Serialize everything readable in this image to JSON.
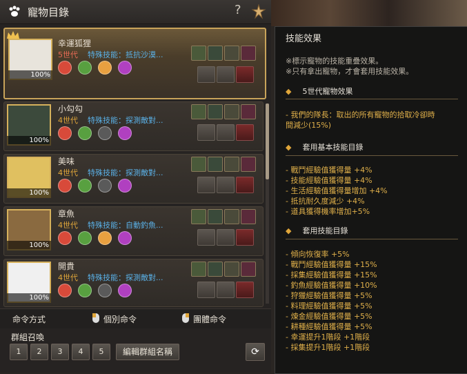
{
  "window": {
    "title": "寵物目錄",
    "help": "?"
  },
  "pets": [
    {
      "name": "幸運狐狸",
      "gen": "5世代",
      "skill": "特殊技能：抵抗沙漠...",
      "pct": "100%"
    },
    {
      "name": "小勾勾",
      "gen": "4世代",
      "skill": "特殊技能：探測敵對...",
      "pct": "100%"
    },
    {
      "name": "美味",
      "gen": "4世代",
      "skill": "特殊技能：探測敵對...",
      "pct": "100%"
    },
    {
      "name": "章魚",
      "gen": "4世代",
      "skill": "特殊技能：自動釣魚...",
      "pct": "100%"
    },
    {
      "name": "開貴",
      "gen": "4世代",
      "skill": "特殊技能：探測敵對...",
      "pct": "100%"
    }
  ],
  "commands": {
    "label": "命令方式",
    "individual": "個別命令",
    "group": "團體命令"
  },
  "group": {
    "label": "群組召喚",
    "buttons": [
      "1",
      "2",
      "3",
      "4",
      "5"
    ],
    "edit": "編輯群組名稱"
  },
  "panel": {
    "title": "技能效果",
    "notes": [
      "※標示寵物的技能重疊效果。",
      "※只有拿出寵物，才會套用技能效果。"
    ],
    "sec1": "5世代寵物效果",
    "sec1_lines": [
      "- 我們的隊長：取出的所有寵物的拾取冷卻時",
      "間減少(15%)"
    ],
    "sec2": "套用基本技能目錄",
    "sec2_lines": [
      "- 戰鬥經驗值獲得量 +4%",
      "- 技能經驗值獲得量 +4%",
      "- 生活經驗值獲得量增加 +4%",
      "- 抵抗耐久度減少 +4%",
      "- 道具獲得機率增加+5%"
    ],
    "sec3": "套用技能目錄",
    "sec3_lines": [
      "- 傾向恢復率 +5%",
      "- 戰鬥經驗值獲得量 +15%",
      "- 採集經驗值獲得量 +15%",
      "- 釣魚經驗值獲得量 +10%",
      "- 狩獵經驗值獲得量 +5%",
      "- 料理經驗值獲得量 +5%",
      "- 煉金經驗值獲得量 +5%",
      "- 耕種經驗值獲得量 +5%",
      "- 幸運提升1階段 +1階段",
      "- 採集提升1階段 +1階段"
    ]
  },
  "colors": {
    "accent": "#e0a63a",
    "skill_blue": "#5ab0e6",
    "gold_border": "#c9a45a"
  }
}
